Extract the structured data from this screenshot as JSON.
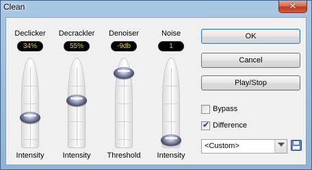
{
  "window": {
    "title": "Clean",
    "close_symbol": "✕"
  },
  "sliders": [
    {
      "id": "declicker",
      "label": "Declicker",
      "readout": "34%",
      "caption": "Intensity",
      "level": 0.34
    },
    {
      "id": "decrackler",
      "label": "Decrackler",
      "readout": "55%",
      "caption": "Intensity",
      "level": 0.55
    },
    {
      "id": "denoiser",
      "label": "Denoiser",
      "readout": "-9db",
      "caption": "Threshold",
      "level": 0.9
    },
    {
      "id": "noise",
      "label": "Noise",
      "readout": "1",
      "caption": "Intensity",
      "level": 0.05
    }
  ],
  "buttons": {
    "ok": "OK",
    "cancel": "Cancel",
    "play_stop": "Play/Stop"
  },
  "options": {
    "bypass": {
      "label": "Bypass",
      "checked": false
    },
    "difference": {
      "label": "Difference",
      "checked": true
    }
  },
  "preset": {
    "value": "<Custom>"
  },
  "colors": {
    "readout_text": "#e8d234",
    "readout_bg": "#000000",
    "title_bar": "#9fc0e0",
    "close_button": "#c94a2e"
  },
  "icons": {
    "checkmark": "checkmark-icon",
    "save": "save-icon",
    "dropdown": "chevron-down-icon"
  }
}
